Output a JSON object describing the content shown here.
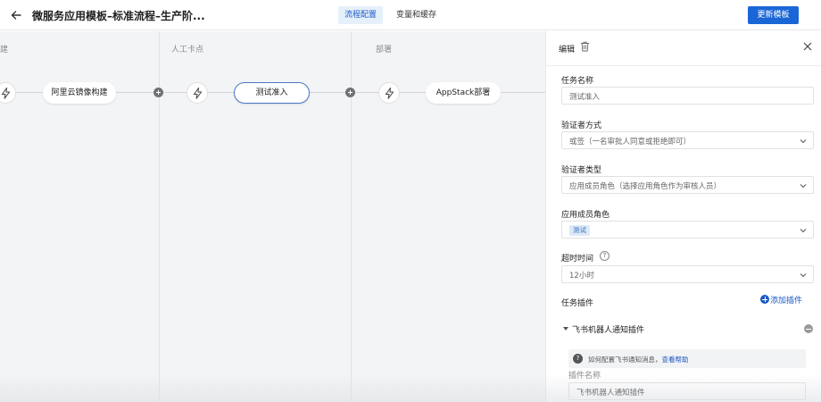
{
  "header": {
    "title": "微服务应用模板–标准流程–生产阶...",
    "tabs": [
      {
        "label": "流程配置",
        "active": true
      },
      {
        "label": "变量和缓存",
        "active": false
      }
    ],
    "update_button": "更新模板",
    "accent": "#1b66d6"
  },
  "canvas": {
    "stages": [
      {
        "label": "建"
      },
      {
        "label": "人工卡点"
      },
      {
        "label": "部署"
      }
    ],
    "nodes": [
      {
        "label": "阿里云镜像构建"
      },
      {
        "label": "测试准入",
        "selected": true
      },
      {
        "label": "AppStack部署"
      }
    ],
    "icons": [
      "bolt-icon",
      "add-node-icon"
    ]
  },
  "panel": {
    "title": "编辑",
    "task_name": {
      "label": "任务名称",
      "value": "测试准入"
    },
    "verifier_mode": {
      "label": "验证者方式",
      "value": "或签（一名审批人同意或拒绝即可）"
    },
    "verifier_type": {
      "label": "验证者类型",
      "value": "应用成员角色（选择应用角色作为审核人员）"
    },
    "member_role": {
      "label": "应用成员角色",
      "tag": "测试"
    },
    "timeout": {
      "label": "超时时间",
      "help": "?",
      "value": "12小时"
    },
    "plugins": {
      "label": "任务插件",
      "add_label": "添加插件",
      "item": {
        "name": "飞书机器人通知插件",
        "info_icon": "?",
        "info_text": "如何配置飞书通知消息，",
        "info_link": "查看帮助",
        "plugin_name_label": "插件名称",
        "plugin_name_value": "飞书机器人通知插件"
      }
    }
  }
}
